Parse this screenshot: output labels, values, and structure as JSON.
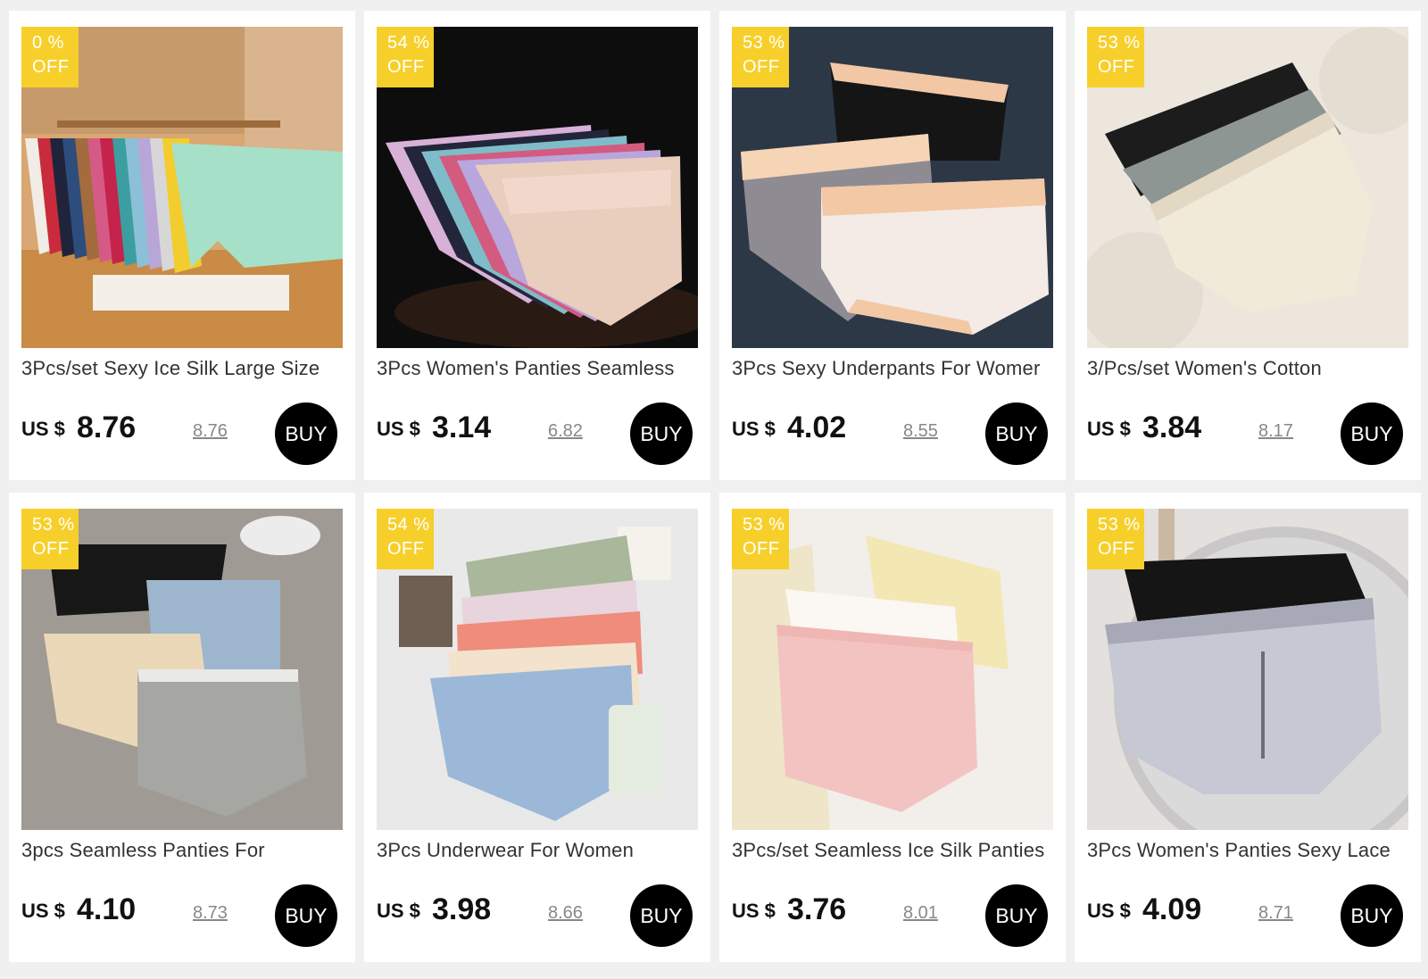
{
  "labels": {
    "off": "OFF",
    "currency": "US $",
    "buy": "BUY"
  },
  "products": [
    {
      "discount": "0 %",
      "title": "3Pcs/set Sexy Ice Silk Large Size",
      "price": "8.76",
      "original_price": "8.76",
      "image": "rainbow-panties-on-rack"
    },
    {
      "discount": "54 %",
      "title": "3Pcs Women's Panties Seamless",
      "price": "3.14",
      "original_price": "6.82",
      "image": "beige-panties-fan-on-black"
    },
    {
      "discount": "53 %",
      "title": "3Pcs Sexy Underpants For Womer",
      "price": "4.02",
      "original_price": "8.55",
      "image": "mesh-panties-peach-trim"
    },
    {
      "discount": "53 %",
      "title": "3/Pcs/set Women's Cotton",
      "price": "3.84",
      "original_price": "8.17",
      "image": "cream-black-panties-on-fur"
    },
    {
      "discount": "53 %",
      "title": "3pcs Seamless Panties For",
      "price": "4.10",
      "original_price": "8.73",
      "image": "ribbed-panties-on-grey-fur"
    },
    {
      "discount": "54 %",
      "title": "3Pcs Underwear For Women",
      "price": "3.98",
      "original_price": "8.66",
      "image": "pastel-panties-stack"
    },
    {
      "discount": "53 %",
      "title": "3Pcs/set Seamless Ice Silk Panties",
      "price": "3.76",
      "original_price": "8.01",
      "image": "pink-yellow-silk-panties"
    },
    {
      "discount": "53 %",
      "title": "3Pcs Women's Panties Sexy Lace",
      "price": "4.09",
      "original_price": "8.71",
      "image": "lace-panties-on-mirror"
    }
  ],
  "colors": {
    "badge": "#f7cf2a",
    "buy_button": "#000000",
    "card_bg": "#ffffff",
    "page_bg": "#f0f0f0"
  }
}
